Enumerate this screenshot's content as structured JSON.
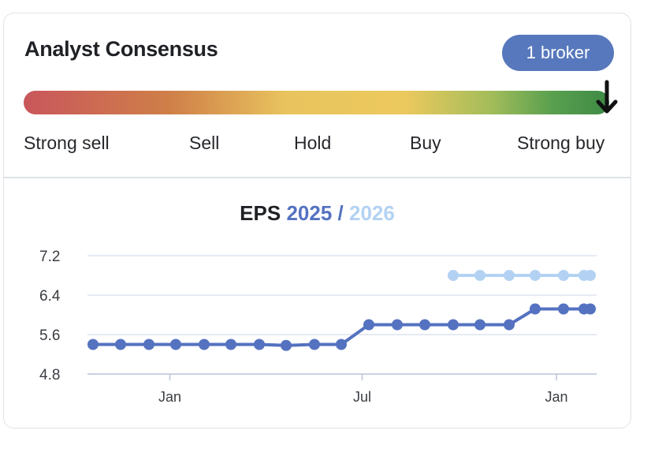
{
  "header": {
    "title": "Analyst Consensus",
    "broker_badge": "1  broker"
  },
  "gauge": {
    "labels": [
      "Strong sell",
      "Sell",
      "Hold",
      "Buy",
      "Strong buy"
    ],
    "consensus_value": 1.0,
    "consensus_label": "Strong buy",
    "colors": [
      "#c9565c",
      "#cf7f48",
      "#ecc95e",
      "#5aa04f",
      "#3d8a44"
    ]
  },
  "eps_header": {
    "lead": "EPS",
    "year1": "2025",
    "separator": "/",
    "year2": "2026"
  },
  "chart_data": {
    "type": "line",
    "title": "EPS 2025 / 2026",
    "xlabel": "",
    "ylabel": "",
    "ylim": [
      4.8,
      7.2
    ],
    "yticks": [
      "7.2",
      "6.4",
      "5.6",
      "4.8"
    ],
    "xticks": [
      {
        "label": "Jan",
        "date": "2024-01-01"
      },
      {
        "label": "Jul",
        "date": "2024-07-01"
      },
      {
        "label": "Jan",
        "date": "2025-01-01"
      }
    ],
    "x_range": [
      "2023-10-15",
      "2025-02-08"
    ],
    "grid": true,
    "series": [
      {
        "name": "2025",
        "color": "#5472c0",
        "points": [
          {
            "x": "2023-10-20",
            "y": 5.4
          },
          {
            "x": "2023-11-20",
            "y": 5.4
          },
          {
            "x": "2023-12-20",
            "y": 5.4
          },
          {
            "x": "2024-01-20",
            "y": 5.4
          },
          {
            "x": "2024-02-20",
            "y": 5.4
          },
          {
            "x": "2024-03-20",
            "y": 5.4
          },
          {
            "x": "2024-04-20",
            "y": 5.4
          },
          {
            "x": "2024-05-20",
            "y": 5.38
          },
          {
            "x": "2024-06-20",
            "y": 5.4
          },
          {
            "x": "2024-07-20",
            "y": 5.4
          },
          {
            "x": "2024-08-18",
            "y": 5.8
          },
          {
            "x": "2024-09-18",
            "y": 5.8
          },
          {
            "x": "2024-10-18",
            "y": 5.8
          },
          {
            "x": "2024-11-18",
            "y": 5.8
          },
          {
            "x": "2024-12-18",
            "y": 5.8
          },
          {
            "x": "2025-01-18",
            "y": 5.8
          },
          {
            "x": "2025-02-18",
            "y": 6.12
          },
          {
            "x": "2025-03-18",
            "y": 6.12
          },
          {
            "x": "2025-04-10",
            "y": 6.12
          },
          {
            "x": "2025-04-20",
            "y": 6.12
          }
        ]
      },
      {
        "name": "2026",
        "color": "#b3d2f3",
        "points": [
          {
            "x": "2024-12-18",
            "y": 6.8
          },
          {
            "x": "2025-01-18",
            "y": 6.8
          },
          {
            "x": "2025-02-18",
            "y": 6.8
          },
          {
            "x": "2025-03-18",
            "y": 6.8
          },
          {
            "x": "2025-04-18",
            "y": 6.8
          },
          {
            "x": "2025-05-10",
            "y": 6.8
          },
          {
            "x": "2025-05-20",
            "y": 6.8
          }
        ]
      }
    ]
  }
}
